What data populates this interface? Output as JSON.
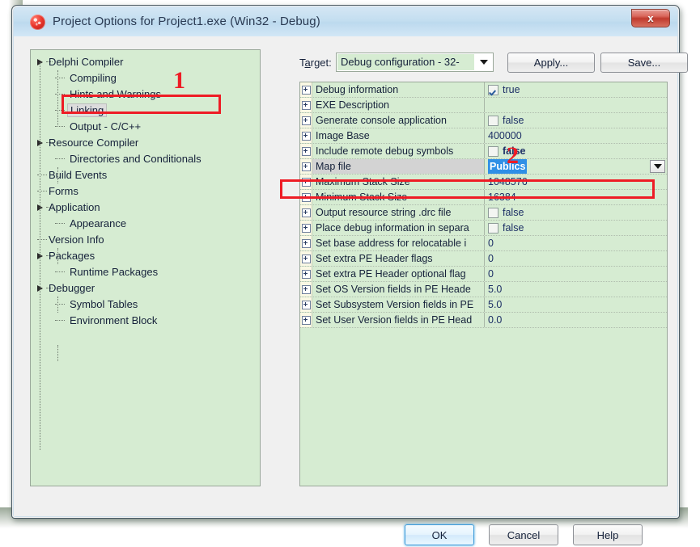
{
  "window": {
    "title_main": "Project Options for Project1.exe",
    "title_sub": "(Win32 - Debug)",
    "app_icon": "globe-icon",
    "close_label": "x"
  },
  "tree": {
    "nodes": [
      {
        "label": "Delphi Compiler",
        "level": 0,
        "expander": true
      },
      {
        "label": "Compiling",
        "level": 1,
        "expander": false
      },
      {
        "label": "Hints and Warnings",
        "level": 1,
        "expander": false
      },
      {
        "label": "Linking",
        "level": 1,
        "expander": false,
        "selected": true
      },
      {
        "label": "Output - C/C++",
        "level": 1,
        "expander": false
      },
      {
        "label": "Resource Compiler",
        "level": 0,
        "expander": true
      },
      {
        "label": "Directories and Conditionals",
        "level": 1,
        "expander": false
      },
      {
        "label": "Build Events",
        "level": 0,
        "expander": false
      },
      {
        "label": "Forms",
        "level": 0,
        "expander": false
      },
      {
        "label": "Application",
        "level": 0,
        "expander": true
      },
      {
        "label": "Appearance",
        "level": 1,
        "expander": false
      },
      {
        "label": "Version Info",
        "level": 0,
        "expander": false
      },
      {
        "label": "Packages",
        "level": 0,
        "expander": true
      },
      {
        "label": "Runtime Packages",
        "level": 1,
        "expander": false
      },
      {
        "label": "Debugger",
        "level": 0,
        "expander": true
      },
      {
        "label": "Symbol Tables",
        "level": 1,
        "expander": false
      },
      {
        "label": "Environment Block",
        "level": 1,
        "expander": false
      }
    ]
  },
  "target": {
    "label_pre": "T",
    "label_accel": "a",
    "label_post": "rget:",
    "value": "Debug configuration - 32-",
    "dropdown_icon": "chevron-down-icon"
  },
  "toolbar": {
    "apply_label": "Apply...",
    "save_label": "Save..."
  },
  "grid": {
    "rows": [
      {
        "name": "Debug information",
        "value": "true",
        "kind": "checkbox",
        "checked": true
      },
      {
        "name": "EXE Description",
        "value": "",
        "kind": "text"
      },
      {
        "name": "Generate console application",
        "value": "false",
        "kind": "checkbox",
        "checked": false
      },
      {
        "name": "Image Base",
        "value": "400000",
        "kind": "text"
      },
      {
        "name": "Include remote debug symbols",
        "value": "false",
        "kind": "checkbox",
        "checked": false,
        "bold": true
      },
      {
        "name": "Map file",
        "value": "Publics",
        "kind": "dropdown",
        "selected": true
      },
      {
        "name": "Maximum Stack Size",
        "value": "1048576",
        "kind": "text"
      },
      {
        "name": "Minimum Stack Size",
        "value": "16384",
        "kind": "text"
      },
      {
        "name": "Output resource string .drc file",
        "value": "false",
        "kind": "checkbox",
        "checked": false
      },
      {
        "name": "Place debug information in separa",
        "value": "false",
        "kind": "checkbox",
        "checked": false
      },
      {
        "name": "Set base address for relocatable i",
        "value": "0",
        "kind": "text"
      },
      {
        "name": "Set extra PE Header flags",
        "value": "0",
        "kind": "text"
      },
      {
        "name": "Set extra PE Header optional flag",
        "value": "0",
        "kind": "text"
      },
      {
        "name": "Set OS Version fields in PE Heade",
        "value": "5.0",
        "kind": "text"
      },
      {
        "name": "Set Subsystem Version fields in PE",
        "value": "5.0",
        "kind": "text"
      },
      {
        "name": "Set User Version fields in PE Head",
        "value": "0.0",
        "kind": "text"
      }
    ]
  },
  "footer": {
    "ok_label": "OK",
    "cancel_label": "Cancel",
    "help_label": "Help"
  },
  "annotations": {
    "marker_1": "1",
    "marker_2": "2",
    "color": "#ee1c25"
  }
}
